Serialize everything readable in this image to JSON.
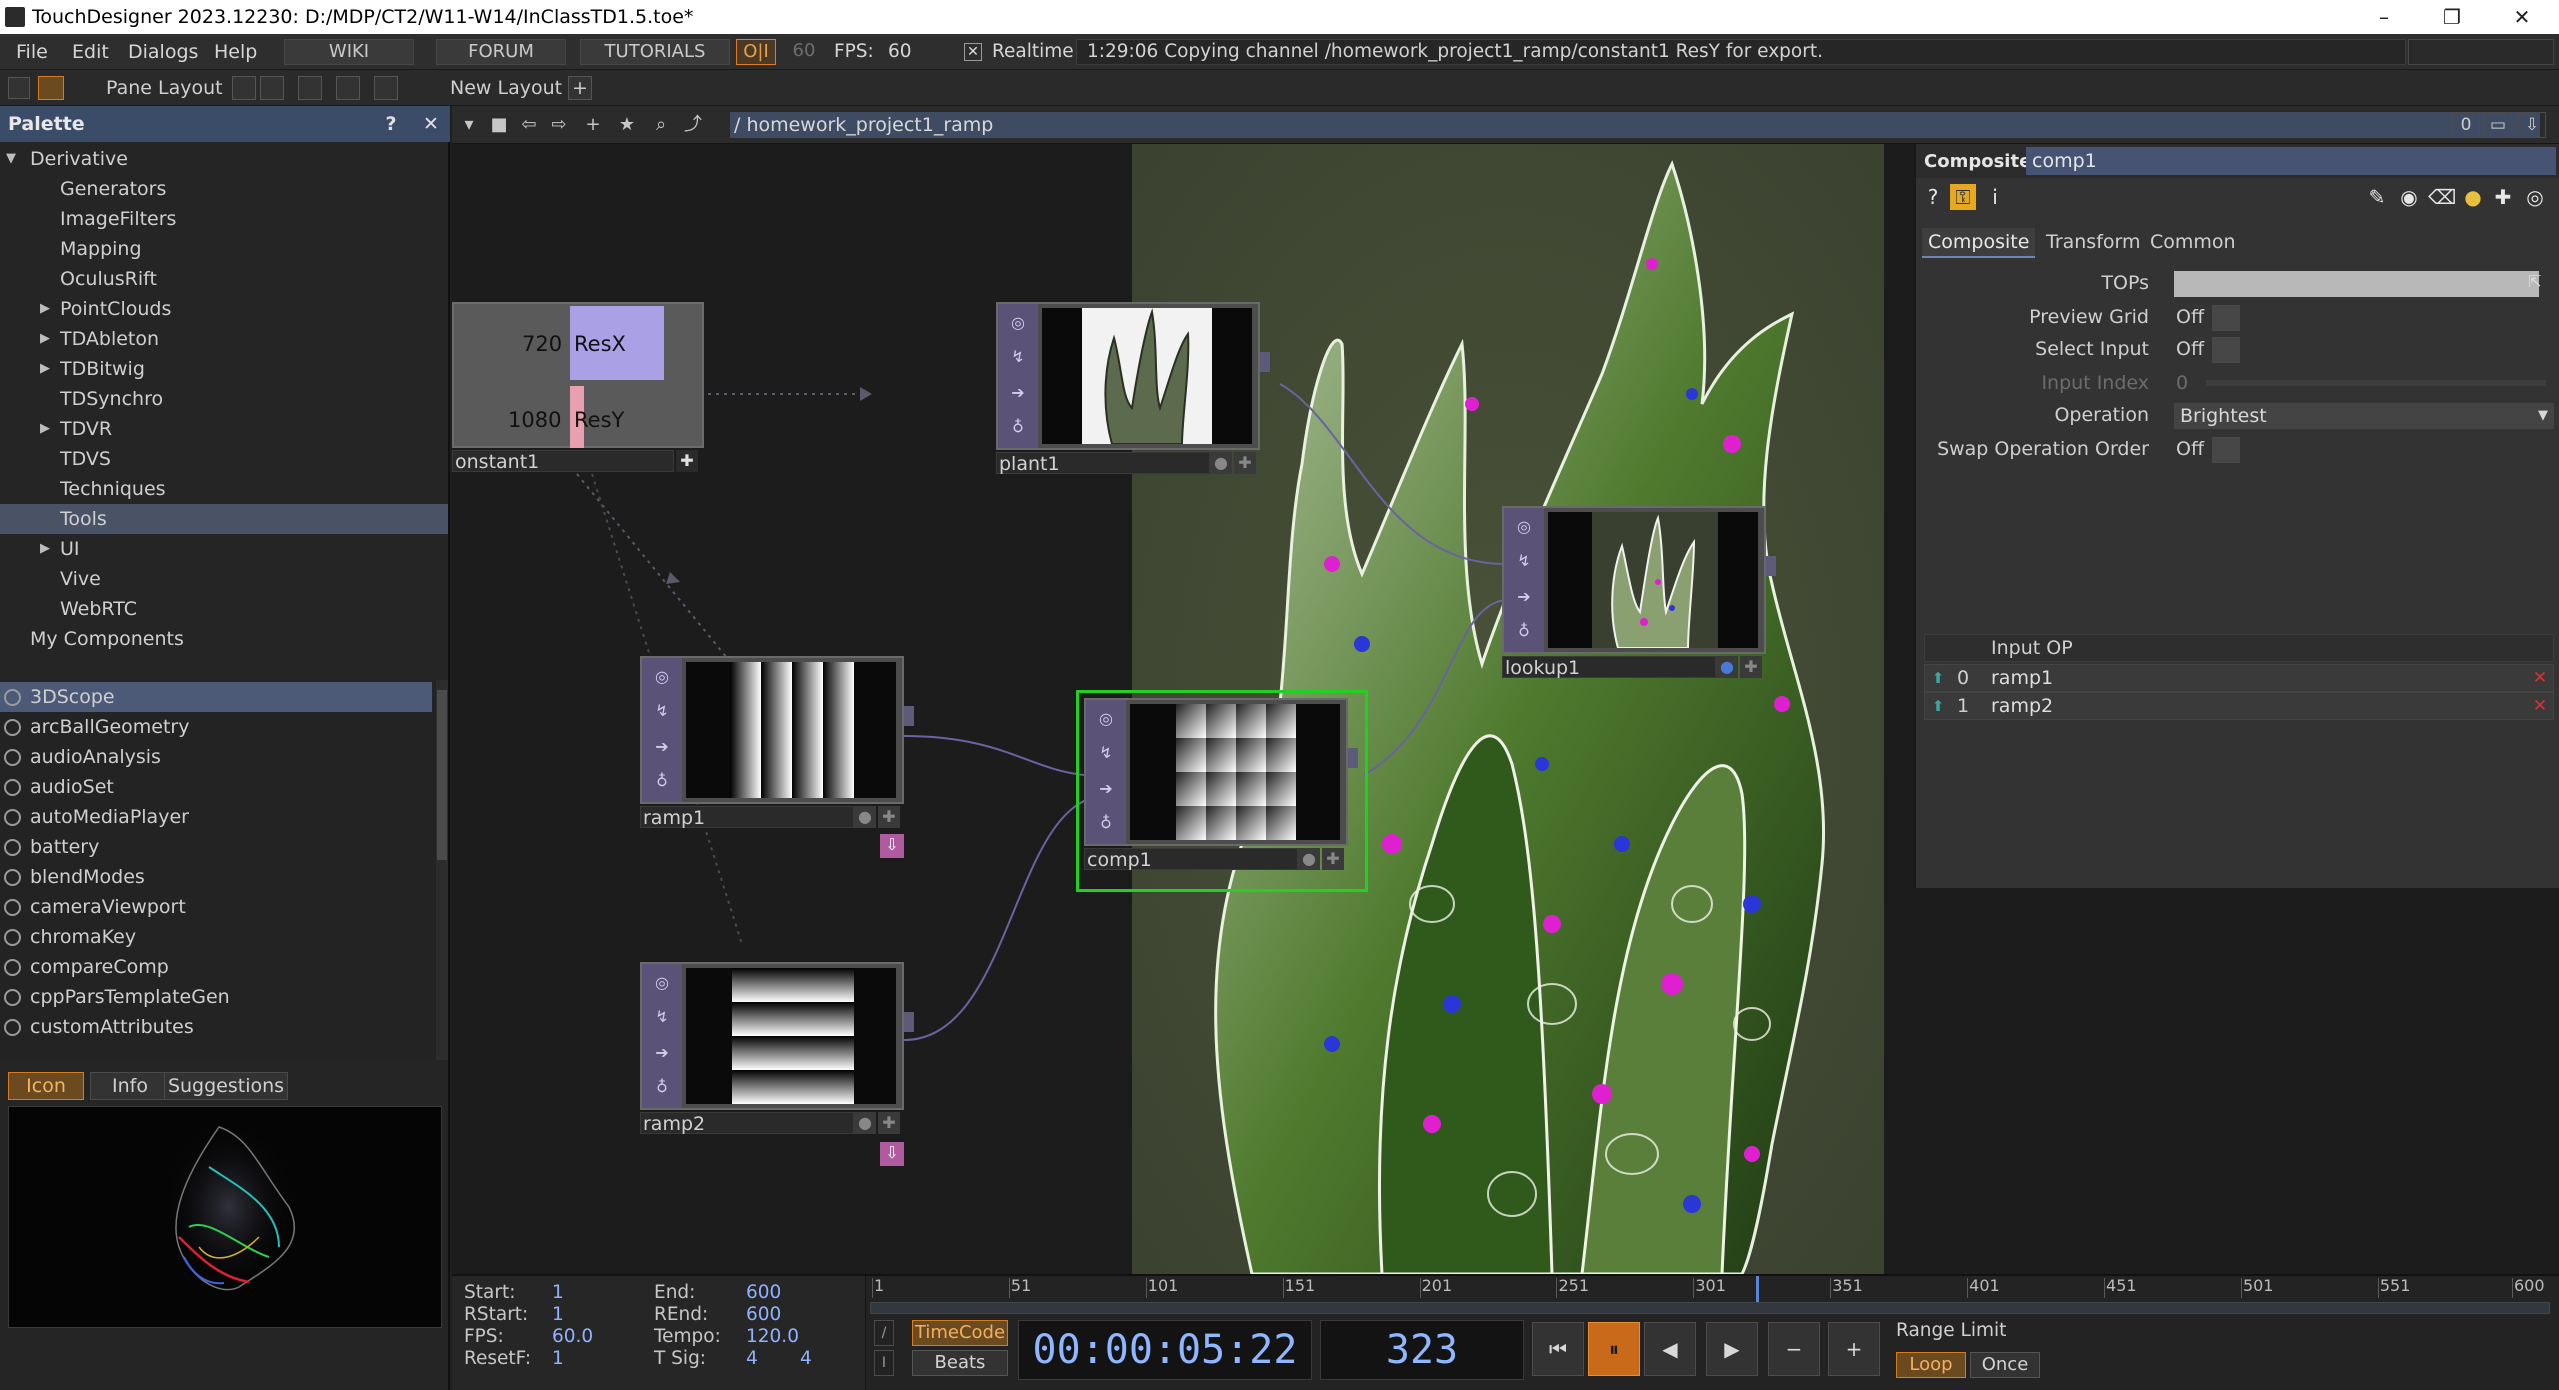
{
  "window": {
    "title": "TouchDesigner 2023.12230: D:/MDP/CT2/W11-W14/InClassTD1.5.toe*",
    "minimize": "–",
    "restore": "❐",
    "close": "✕"
  },
  "menu": {
    "items": [
      "File",
      "Edit",
      "Dialogs",
      "Help"
    ],
    "wiki": "WIKI",
    "forum": "FORUM",
    "tutorials": "TUTORIALS",
    "oi": "O|I",
    "fps_cap": "60",
    "fps_label": "FPS:",
    "fps_value": "60",
    "realtime_check": "✕",
    "realtime": "Realtime",
    "status": "1:29:06 Copying channel /homework_project1_ramp/constant1 ResY for export."
  },
  "layoutbar": {
    "pane_layout": "Pane Layout",
    "new_layout": "New Layout",
    "add": "+"
  },
  "palette": {
    "title": "Palette",
    "help": "?",
    "close": "✕",
    "tree": [
      {
        "label": "Derivative",
        "level": 0,
        "arrow": "▼",
        "selected": false
      },
      {
        "label": "Generators",
        "level": 2,
        "arrow": "",
        "selected": false
      },
      {
        "label": "ImageFilters",
        "level": 2,
        "arrow": "",
        "selected": false
      },
      {
        "label": "Mapping",
        "level": 2,
        "arrow": "",
        "selected": false
      },
      {
        "label": "OculusRift",
        "level": 2,
        "arrow": "",
        "selected": false
      },
      {
        "label": "PointClouds",
        "level": 1,
        "arrow": "▶",
        "selected": false
      },
      {
        "label": "TDAbleton",
        "level": 1,
        "arrow": "▶",
        "selected": false
      },
      {
        "label": "TDBitwig",
        "level": 1,
        "arrow": "▶",
        "selected": false
      },
      {
        "label": "TDSynchro",
        "level": 2,
        "arrow": "",
        "selected": false
      },
      {
        "label": "TDVR",
        "level": 1,
        "arrow": "▶",
        "selected": false
      },
      {
        "label": "TDVS",
        "level": 2,
        "arrow": "",
        "selected": false
      },
      {
        "label": "Techniques",
        "level": 2,
        "arrow": "",
        "selected": false
      },
      {
        "label": "Tools",
        "level": 2,
        "arrow": "",
        "selected": true
      },
      {
        "label": "UI",
        "level": 1,
        "arrow": "▶",
        "selected": false
      },
      {
        "label": "Vive",
        "level": 2,
        "arrow": "",
        "selected": false
      },
      {
        "label": "WebRTC",
        "level": 2,
        "arrow": "",
        "selected": false
      },
      {
        "label": "My Components",
        "level": 3,
        "arrow": "",
        "selected": false
      }
    ],
    "items": [
      "3DScope",
      "arcBallGeometry",
      "audioAnalysis",
      "audioSet",
      "autoMediaPlayer",
      "battery",
      "blendModes",
      "cameraViewport",
      "chromaKey",
      "compareComp",
      "cppParsTemplateGen",
      "customAttributes"
    ],
    "selected_item": "3DScope",
    "tabs": [
      "Icon",
      "Info",
      "Suggestions"
    ],
    "active_tab": "Icon"
  },
  "network": {
    "path": "/ homework_project1_ramp",
    "right_count": "0",
    "nodes": {
      "constant1": {
        "name": "onstant1",
        "resx_value": "720",
        "resx_label": "ResX",
        "resy_value": "1080",
        "resy_label": "ResY"
      },
      "plant1": {
        "name": "plant1"
      },
      "lookup1": {
        "name": "lookup1"
      },
      "ramp1": {
        "name": "ramp1"
      },
      "ramp2": {
        "name": "ramp2"
      },
      "comp1": {
        "name": "comp1"
      }
    }
  },
  "params": {
    "op_type": "Composite",
    "op_name": "comp1",
    "tabs": [
      "Composite",
      "Transform",
      "Common"
    ],
    "active_tab": "Composite",
    "tops_label": "TOPs",
    "preview_grid_label": "Preview Grid",
    "preview_grid_value": "Off",
    "select_input_label": "Select Input",
    "select_input_value": "Off",
    "input_index_label": "Input Index",
    "input_index_value": "0",
    "operation_label": "Operation",
    "operation_value": "Brightest",
    "swap_label": "Swap Operation Order",
    "swap_value": "Off",
    "sequence_header": "Input OP",
    "inputs": [
      {
        "index": "0",
        "op": "ramp1"
      },
      {
        "index": "1",
        "op": "ramp2"
      }
    ]
  },
  "timeline": {
    "start_label": "Start:",
    "start": "1",
    "end_label": "End:",
    "end": "600",
    "rstart_label": "RStart:",
    "rstart": "1",
    "rend_label": "REnd:",
    "rend": "600",
    "fps_label": "FPS:",
    "fps": "60.0",
    "tempo_label": "Tempo:",
    "tempo": "120.0",
    "resetf_label": "ResetF:",
    "resetf": "1",
    "tsig_label": "T Sig:",
    "tsig_a": "4",
    "tsig_b": "4",
    "ticks": [
      "1",
      "51",
      "101",
      "151",
      "201",
      "251",
      "301",
      "351",
      "401",
      "451",
      "501",
      "551",
      "600"
    ],
    "timecode_btn": "TimeCode",
    "beats_btn": "Beats",
    "timecode": "00:00:05:22",
    "frame": "323",
    "current_frame": 323,
    "range_limit_label": "Range Limit",
    "loop_btn": "Loop",
    "once_btn": "Once"
  },
  "colors": {
    "accent_orange": "#d37c24",
    "selection_blue": "#3b4c68",
    "node_selected_green": "#22d022",
    "top_node_purple": "#5a5277"
  }
}
